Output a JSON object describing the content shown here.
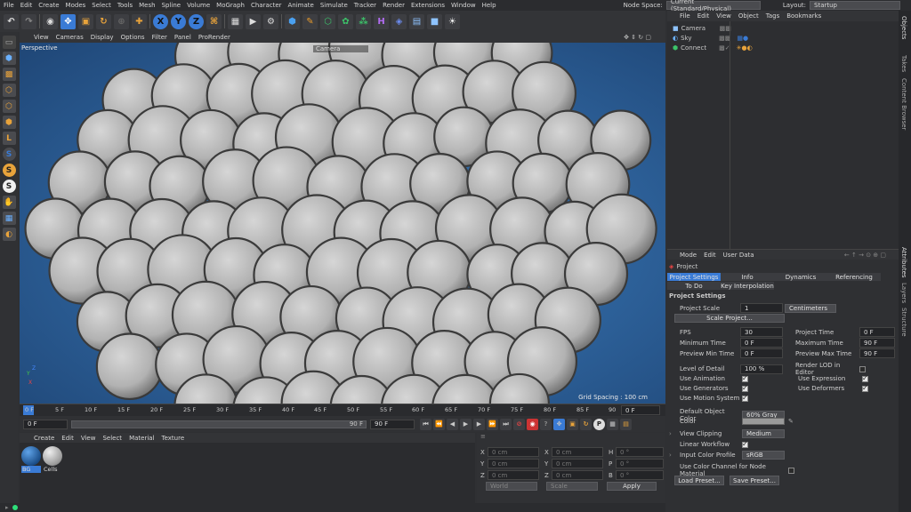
{
  "menubar": {
    "items": [
      "File",
      "Edit",
      "Create",
      "Modes",
      "Select",
      "Tools",
      "Mesh",
      "Spline",
      "Volume",
      "MoGraph",
      "Character",
      "Animate",
      "Simulate",
      "Tracker",
      "Render",
      "Extensions",
      "Window",
      "Help"
    ],
    "node_space_label": "Node Space:",
    "node_space_value": "Current (Standard/Physical)",
    "layout_label": "Layout:",
    "layout_value": "Startup"
  },
  "toolbar": {
    "axis_x": "X",
    "axis_y": "Y",
    "axis_z": "Z"
  },
  "viewport": {
    "menu": [
      "View",
      "Cameras",
      "Display",
      "Options",
      "Filter",
      "Panel",
      "ProRender"
    ],
    "label": "Perspective",
    "camera_label": "Camera",
    "grid_spacing": "Grid Spacing : 100 cm",
    "axis_x": "X",
    "axis_y": "Y",
    "axis_z": "Z"
  },
  "timeline": {
    "ticks": [
      "0 F",
      "5 F",
      "10 F",
      "15 F",
      "20 F",
      "25 F",
      "30 F",
      "35 F",
      "40 F",
      "45 F",
      "50 F",
      "55 F",
      "60 F",
      "65 F",
      "70 F",
      "75 F",
      "80 F",
      "85 F",
      "90"
    ],
    "current_frame": "0 F"
  },
  "playbar": {
    "start": "0 F",
    "end": "90 F",
    "end2": "90 F"
  },
  "materials": {
    "menu": [
      "Create",
      "Edit",
      "View",
      "Select",
      "Material",
      "Texture"
    ],
    "items": [
      {
        "name": "BG"
      },
      {
        "name": "Cells"
      }
    ]
  },
  "coords": {
    "rows": [
      {
        "a": "X",
        "av": "0 cm",
        "b": "X",
        "bv": "0 cm",
        "c": "H",
        "cv": "0 °"
      },
      {
        "a": "Y",
        "av": "0 cm",
        "b": "Y",
        "bv": "0 cm",
        "c": "P",
        "cv": "0 °"
      },
      {
        "a": "Z",
        "av": "0 cm",
        "b": "Z",
        "bv": "0 cm",
        "c": "B",
        "cv": "0 °"
      }
    ],
    "mode": "World",
    "scale": "Scale",
    "apply": "Apply"
  },
  "objects": {
    "menu": [
      "File",
      "Edit",
      "View",
      "Object",
      "Tags",
      "Bookmarks"
    ],
    "items": [
      {
        "name": "Camera"
      },
      {
        "name": "Sky"
      },
      {
        "name": "Connect"
      }
    ]
  },
  "attributes": {
    "menu": [
      "Mode",
      "Edit",
      "User Data"
    ],
    "title": "Project",
    "tabs": [
      "Project Settings",
      "Info",
      "Dynamics",
      "Referencing",
      "To Do",
      "Key Interpolation"
    ],
    "section": "Project Settings",
    "project_scale_label": "Project Scale",
    "project_scale_value": "1",
    "project_scale_unit": "Centimeters",
    "scale_project_btn": "Scale Project...",
    "fps_label": "FPS",
    "fps_value": "30",
    "project_time_label": "Project Time",
    "project_time_value": "0 F",
    "min_time_label": "Minimum Time",
    "min_time_value": "0 F",
    "max_time_label": "Maximum Time",
    "max_time_value": "90 F",
    "prev_min_label": "Preview Min Time",
    "prev_min_value": "0 F",
    "prev_max_label": "Preview Max Time",
    "prev_max_value": "90 F",
    "lod_label": "Level of Detail",
    "lod_value": "100 %",
    "render_lod_label": "Render LOD in Editor",
    "use_animation": "Use Animation",
    "use_expression": "Use Expression",
    "use_generators": "Use Generators",
    "use_deformers": "Use Deformers",
    "use_motion": "Use Motion System",
    "default_color_label": "Default Object Color",
    "default_color_value": "60% Gray",
    "color_label": "Color",
    "view_clipping_label": "View Clipping",
    "view_clipping_value": "Medium",
    "linear_workflow_label": "Linear Workflow",
    "input_profile_label": "Input Color Profile",
    "input_profile_value": "sRGB",
    "use_color_channel_label": "Use Color Channel for Node Material",
    "load_preset": "Load Preset...",
    "save_preset": "Save Preset..."
  },
  "right_tabs": [
    "Objects",
    "Takes",
    "Content Browser",
    "Attributes",
    "Layers",
    "Structure"
  ]
}
